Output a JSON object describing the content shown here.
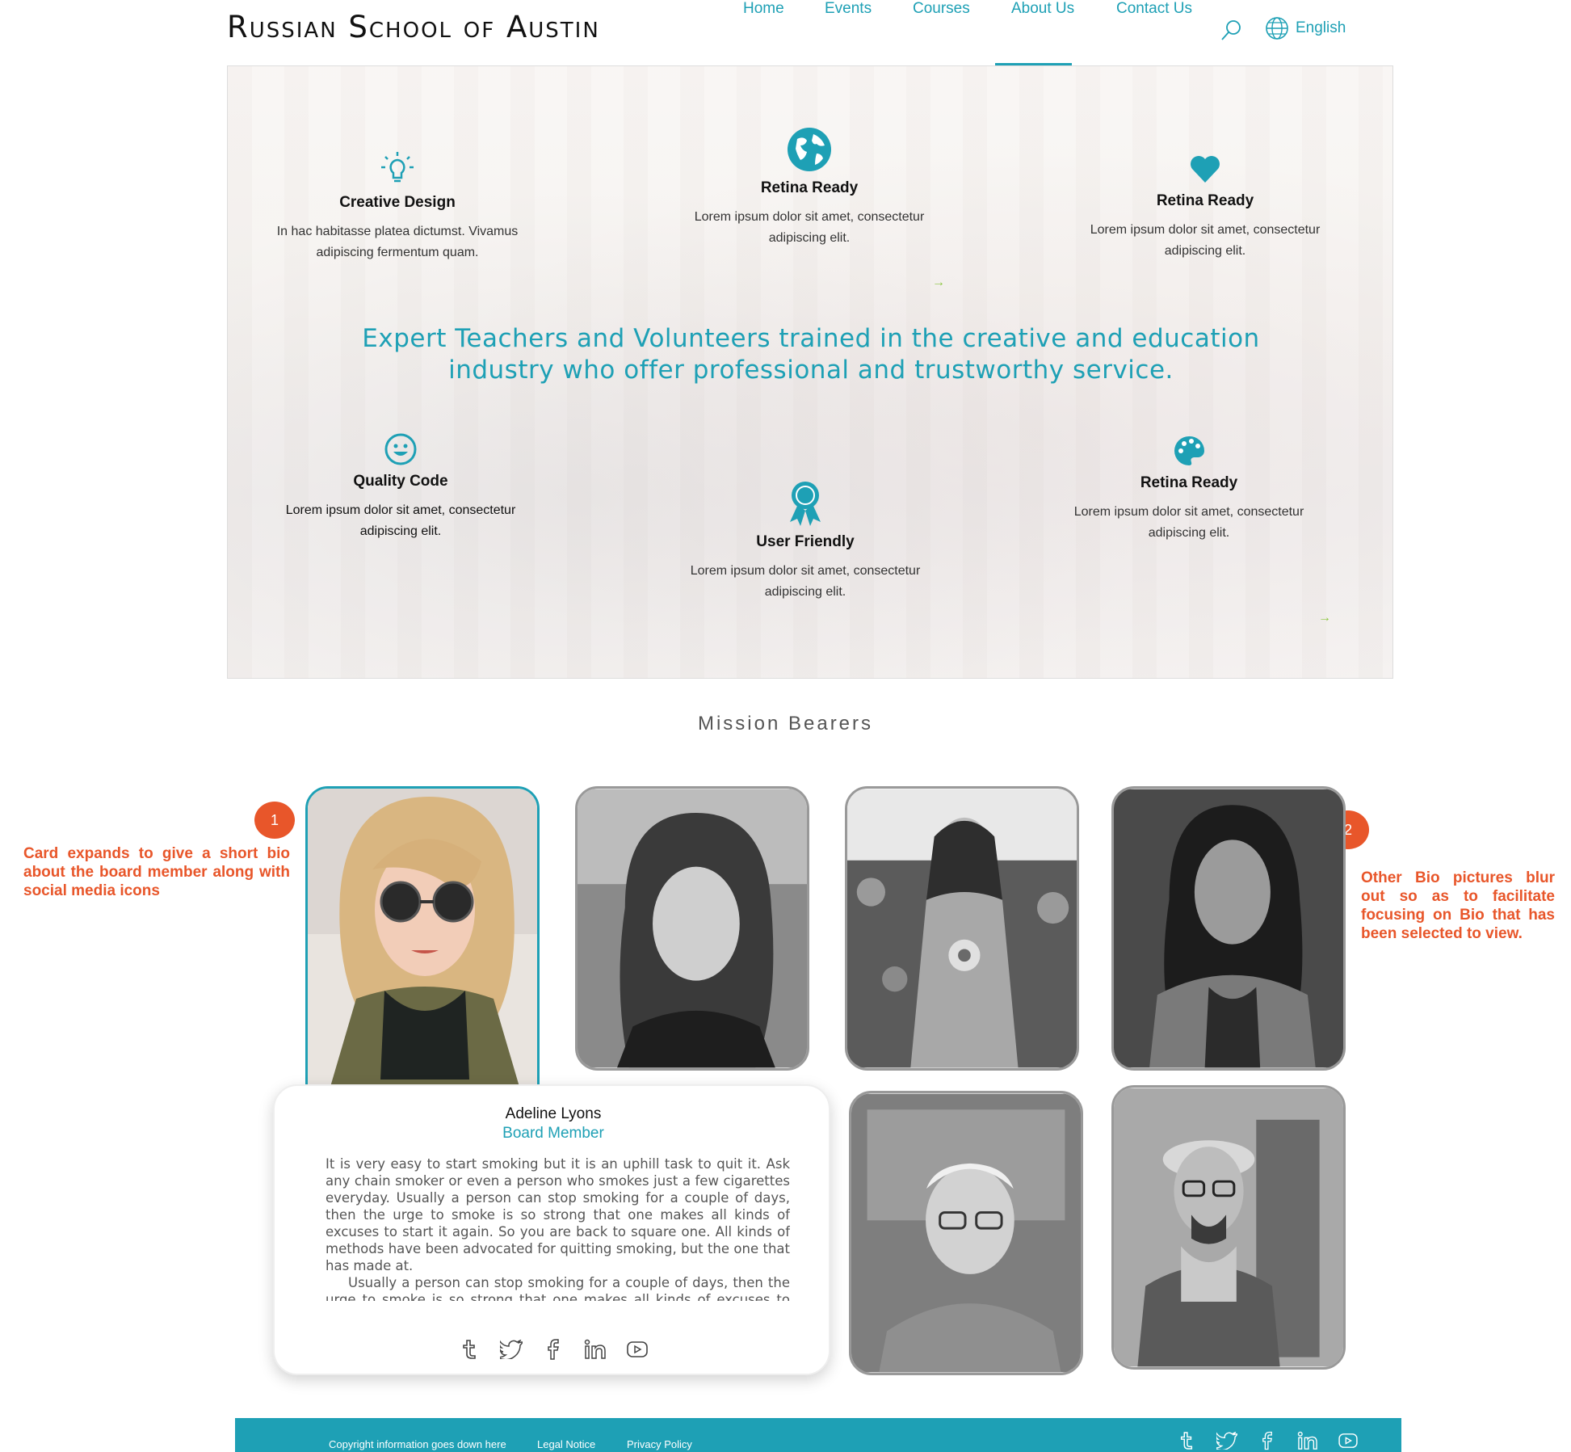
{
  "header": {
    "logo": "Russian School of Austin",
    "nav": [
      {
        "label": "Home"
      },
      {
        "label": "Events"
      },
      {
        "label": "Courses"
      },
      {
        "label": "About Us"
      },
      {
        "label": "Contact Us"
      }
    ],
    "active_nav": "About Us",
    "language": "English"
  },
  "hero": {
    "features_top": [
      {
        "title": "Creative Design",
        "text": "In hac habitasse platea dictumst. Vivamus adipiscing fermentum quam.",
        "icon": "lightbulb-icon"
      },
      {
        "title": "Retina Ready",
        "text": "Lorem ipsum dolor sit amet, consectetur adipiscing elit.",
        "icon": "globe-icon"
      },
      {
        "title": "Retina Ready",
        "text": "Lorem ipsum dolor sit amet, consectetur adipiscing elit.",
        "icon": "heart-icon"
      }
    ],
    "headline_line1": "Expert Teachers and Volunteers trained in the creative and education",
    "headline_line2": "industry who offer professional and trustworthy service.",
    "features_bottom": [
      {
        "title": "Quality Code",
        "text": "Lorem ipsum dolor sit amet, consectetur adipiscing elit.",
        "icon": "smiley-icon"
      },
      {
        "title": "User Friendly",
        "text": "Lorem ipsum dolor sit amet, consectetur adipiscing elit.",
        "icon": "award-ribbon-icon"
      },
      {
        "title": "Retina Ready",
        "text": "Lorem ipsum dolor sit amet, consectetur adipiscing elit.",
        "icon": "palette-icon"
      }
    ],
    "arrow": "→"
  },
  "mission": {
    "title": "Mission Bearers",
    "annotation_1": {
      "number": "1",
      "text": "Card expands to give a short bio about the board member along with social media icons"
    },
    "annotation_2": {
      "number": "2",
      "text": "Other Bio pictures blur out so as to facilitate focusing on Bio that has been selected to view."
    },
    "selected": {
      "name": "Adeline Lyons",
      "role": "Board Member",
      "bio_p1": "It is very easy to start smoking but it is an uphill task to quit it. Ask any chain smoker or even a person who smokes just a few cigarettes everyday. Usually a person can stop smoking for a couple of days, then the urge to smoke is so strong that one makes all kinds of excuses to start it again. So you are back to square one. All kinds of methods have been advocated for quitting smoking, but the one that has made at.",
      "bio_p2": "Usually a person can stop smoking for a couple of days, then the urge to smoke is so strong that one makes all kinds of excuses to start it again.",
      "social": [
        "tumblr-icon",
        "twitter-icon",
        "facebook-icon",
        "linkedin-icon",
        "youtube-icon"
      ]
    }
  },
  "footer": {
    "copyright": "Copyright information goes down here",
    "legal": "Legal Notice",
    "privacy": "Privacy Policy",
    "social": [
      "tumblr-icon",
      "twitter-icon",
      "facebook-icon",
      "linkedin-icon",
      "youtube-icon"
    ]
  },
  "colors": {
    "accent": "#1ea0b5",
    "annotation": "#e8562a",
    "arrow": "#8cc63f"
  }
}
